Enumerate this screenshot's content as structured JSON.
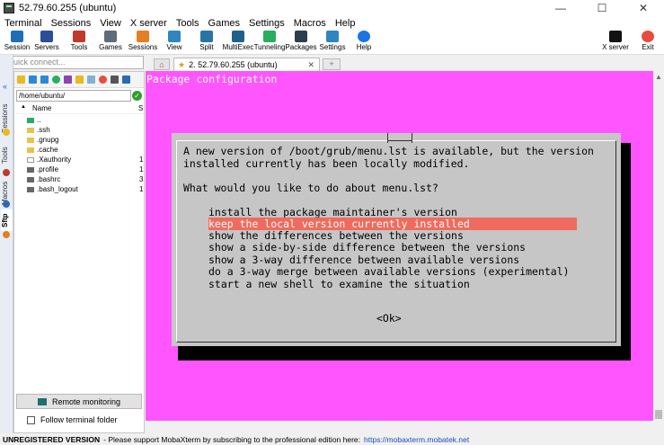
{
  "window": {
    "title": "52.79.60.255 (ubuntu)",
    "controls": [
      "—",
      "☐",
      "✕"
    ]
  },
  "menu": [
    "Terminal",
    "Sessions",
    "View",
    "X server",
    "Tools",
    "Games",
    "Settings",
    "Macros",
    "Help"
  ],
  "toolbar": {
    "items": [
      {
        "label": "Session",
        "icon": "session-icon",
        "color": "#1e6fb8"
      },
      {
        "label": "Servers",
        "icon": "servers-icon",
        "color": "#2a4e9a"
      },
      {
        "label": "Tools",
        "icon": "tools-icon",
        "color": "#c0392b"
      },
      {
        "label": "Games",
        "icon": "games-icon",
        "color": "#5d6d7e"
      },
      {
        "label": "Sessions",
        "icon": "sessions-icon",
        "color": "#e67e22"
      },
      {
        "label": "View",
        "icon": "view-icon",
        "color": "#2e86c1"
      },
      {
        "label": "Split",
        "icon": "split-icon",
        "color": "#2874a6"
      },
      {
        "label": "MultiExec",
        "icon": "multiexec-icon",
        "color": "#1f618d"
      },
      {
        "label": "Tunneling",
        "icon": "tunneling-icon",
        "color": "#27ae60"
      },
      {
        "label": "Packages",
        "icon": "packages-icon",
        "color": "#2c3e50"
      },
      {
        "label": "Settings",
        "icon": "settings-icon",
        "color": "#2e86c1"
      },
      {
        "label": "Help",
        "icon": "help-icon",
        "color": "#1a73e8"
      }
    ],
    "right_items": [
      {
        "label": "X server",
        "icon": "x-server-icon",
        "color": "#111111"
      },
      {
        "label": "Exit",
        "icon": "exit-icon",
        "color": "#e74c3c"
      }
    ]
  },
  "sidebar": {
    "quick_connect_placeholder": "Quick connect...",
    "vertical_tabs": [
      "Sessions",
      "Tools",
      "Macros",
      "Sftp"
    ],
    "path": "/home/ubuntu/",
    "column_name": "Name",
    "column_size": "S",
    "files": [
      {
        "name": "..",
        "size": "",
        "kind": "up"
      },
      {
        "name": ".ssh",
        "size": "",
        "kind": "folder"
      },
      {
        "name": ".gnupg",
        "size": "",
        "kind": "folder"
      },
      {
        "name": ".cache",
        "size": "",
        "kind": "folder"
      },
      {
        "name": ".Xauthority",
        "size": "1",
        "kind": "file"
      },
      {
        "name": ".profile",
        "size": "1",
        "kind": "dark"
      },
      {
        "name": ".bashrc",
        "size": "3",
        "kind": "dark"
      },
      {
        "name": ".bash_logout",
        "size": "1",
        "kind": "dark"
      }
    ],
    "remote_monitoring": "Remote monitoring",
    "follow_terminal_folder": "Follow terminal folder"
  },
  "tabs": {
    "active_label": "2. 52.79.60.255 (ubuntu)"
  },
  "terminal": {
    "header": "Package configuration",
    "background": "#ff55ff",
    "dialog": {
      "message_lines": [
        "A new version of /boot/grub/menu.lst is available, but the version",
        "installed currently has been locally modified."
      ],
      "question": "What would you like to do about menu.lst?",
      "options": [
        "install the package maintainer's version",
        "keep the local version currently installed",
        "show the differences between the versions",
        "show a side-by-side difference between the versions",
        "show a 3-way difference between available versions",
        "do a 3-way merge between available versions (experimental)",
        "start a new shell to examine the situation"
      ],
      "selected_index": 1,
      "ok_button": "<Ok>"
    }
  },
  "statusbar": {
    "unregistered": "UNREGISTERED VERSION",
    "message": "-  Please support MobaXterm by subscribing to the professional edition here:",
    "link": "https://mobaxterm.mobatek.net"
  }
}
